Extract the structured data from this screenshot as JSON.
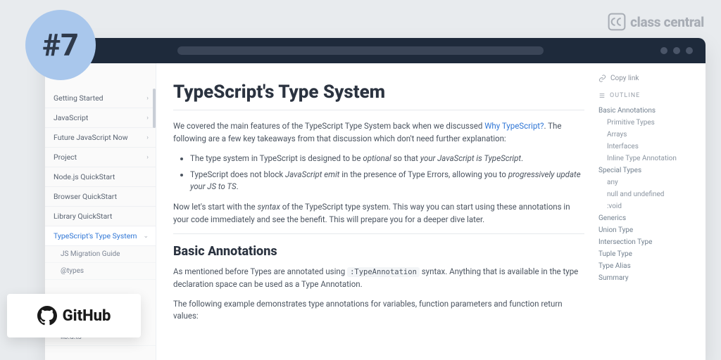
{
  "brand": {
    "rank_badge": "#7",
    "class_central": "class central",
    "github": "GitHub"
  },
  "sidebar": {
    "items": [
      {
        "label": "Getting Started",
        "expandable": true
      },
      {
        "label": "JavaScript",
        "expandable": true
      },
      {
        "label": "Future JavaScript Now",
        "expandable": true
      },
      {
        "label": "Project",
        "expandable": true
      },
      {
        "label": "Node.js QuickStart",
        "expandable": false
      },
      {
        "label": "Browser QuickStart",
        "expandable": false
      },
      {
        "label": "Library QuickStart",
        "expandable": false
      }
    ],
    "active": {
      "label": "TypeScript's Type System",
      "children": [
        {
          "label": "JS Migration Guide"
        },
        {
          "label": "@types"
        },
        {
          "label": "lib.d.ts"
        }
      ]
    }
  },
  "article": {
    "title": "TypeScript's Type System",
    "intro_pre": "We covered the main features of the TypeScript Type System back when we discussed ",
    "intro_link": "Why TypeScript?",
    "intro_post": ". The following are a few key takeaways from that discussion which don't need further explanation:",
    "bullet1_a": "The type system in TypeScript is designed to be ",
    "bullet1_b": "optional",
    "bullet1_c": " so that ",
    "bullet1_d": "your JavaScript is TypeScript",
    "bullet1_e": ".",
    "bullet2_a": "TypeScript does not block ",
    "bullet2_b": "JavaScript emit",
    "bullet2_c": " in the presence of Type Errors, allowing you to ",
    "bullet2_d": "progressively update your JS to TS",
    "bullet2_e": ".",
    "para2_a": "Now let's start with the ",
    "para2_b": "syntax",
    "para2_c": " of the TypeScript type system. This way you can start using these annotations in your code immediately and see the benefit. This will prepare you for a deeper dive later.",
    "h2": "Basic Annotations",
    "para3_a": "As mentioned before Types are annotated using ",
    "para3_code": ":TypeAnnotation",
    "para3_b": " syntax. Anything that is available in the type declaration space can be used as a Type Annotation.",
    "para4": "The following example demonstrates type annotations for variables, function parameters and function return values:"
  },
  "rail": {
    "copy": "Copy link",
    "outline": "OUTLINE",
    "toc": [
      {
        "label": "Basic Annotations",
        "lvl": 1
      },
      {
        "label": "Primitive Types",
        "lvl": 2
      },
      {
        "label": "Arrays",
        "lvl": 2
      },
      {
        "label": "Interfaces",
        "lvl": 2
      },
      {
        "label": "Inline Type Annotation",
        "lvl": 2
      },
      {
        "label": "Special Types",
        "lvl": 1
      },
      {
        "label": "any",
        "lvl": 2
      },
      {
        "label": "null and undefined",
        "lvl": 2
      },
      {
        "label": ":void",
        "lvl": 2
      },
      {
        "label": "Generics",
        "lvl": 1
      },
      {
        "label": "Union Type",
        "lvl": 1
      },
      {
        "label": "Intersection Type",
        "lvl": 1
      },
      {
        "label": "Tuple Type",
        "lvl": 1
      },
      {
        "label": "Type Alias",
        "lvl": 1
      },
      {
        "label": "Summary",
        "lvl": 1
      }
    ]
  }
}
